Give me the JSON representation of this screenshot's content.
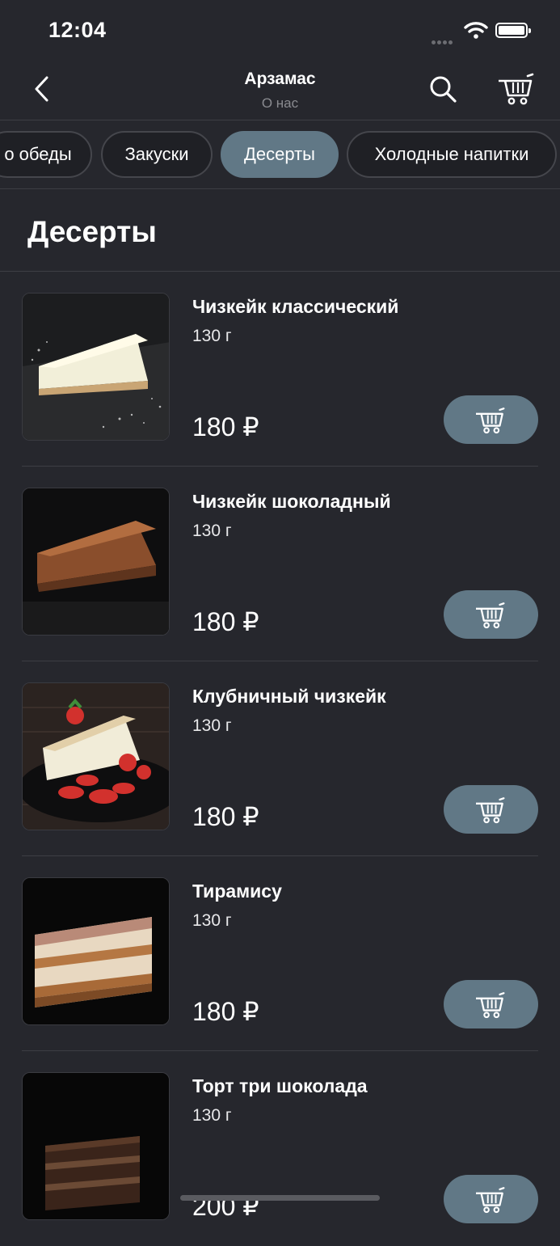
{
  "status_bar": {
    "time": "12:04"
  },
  "nav": {
    "title": "Арзамас",
    "subtitle": "О нас"
  },
  "categories": [
    {
      "label": "о обеды",
      "active": false
    },
    {
      "label": "Закуски",
      "active": false
    },
    {
      "label": "Десерты",
      "active": true
    },
    {
      "label": "Холодные напитки",
      "active": false
    }
  ],
  "section": {
    "title": "Десерты"
  },
  "products": [
    {
      "name": "Чизкейк классический",
      "weight": "130 г",
      "price": "180 ₽"
    },
    {
      "name": "Чизкейк шоколадный",
      "weight": "130 г",
      "price": "180 ₽"
    },
    {
      "name": "Клубничный чизкейк",
      "weight": "130 г",
      "price": "180 ₽"
    },
    {
      "name": "Тирамису",
      "weight": "130 г",
      "price": "180 ₽"
    },
    {
      "name": "Торт три шоколада",
      "weight": "130 г",
      "price": "200 ₽"
    }
  ],
  "colors": {
    "background": "#26272d",
    "accent": "#617886",
    "chip_background": "#1f2025"
  }
}
